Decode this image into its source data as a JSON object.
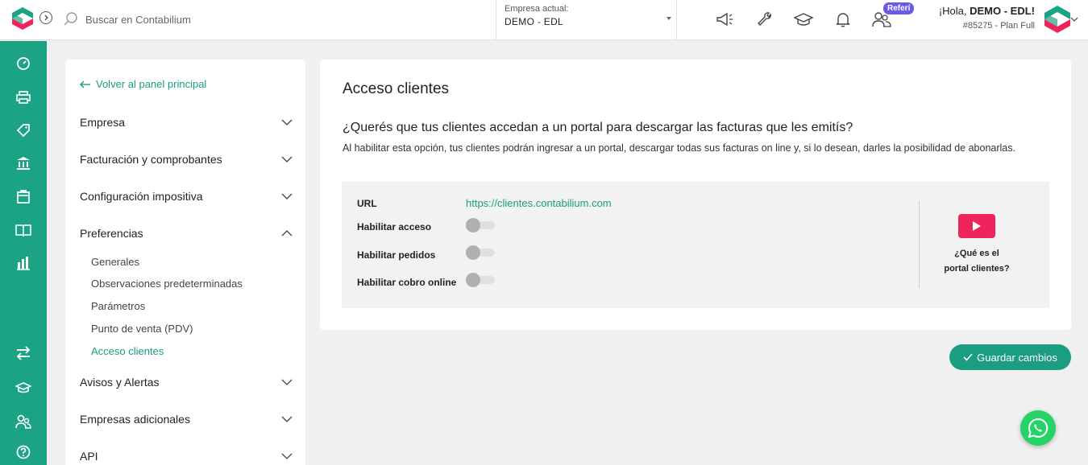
{
  "topbar": {
    "search_placeholder": "Buscar en Contabilium",
    "company_label": "Empresa actual:",
    "company_value": "DEMO - EDL",
    "referi_badge": "Referí",
    "greeting_prefix": "¡Hola, ",
    "user_name": "DEMO - EDL!",
    "plan": "#85275 - Plan Full",
    "icons": [
      "megaphone-icon",
      "wrench-icon",
      "graduation-cap-icon",
      "bell-icon",
      "users-icon"
    ]
  },
  "rail": {
    "icons": [
      "dashboard-icon",
      "printer-icon",
      "tag-icon",
      "bank-icon",
      "bag-icon",
      "book-icon",
      "chart-icon",
      "transfer-icon",
      "academy-icon",
      "contacts-icon",
      "help-icon"
    ]
  },
  "settings": {
    "back_label": "Volver al panel principal",
    "sections": [
      {
        "label": "Empresa",
        "expanded": false
      },
      {
        "label": "Facturación y comprobantes",
        "expanded": false
      },
      {
        "label": "Configuración impositiva",
        "expanded": false
      },
      {
        "label": "Preferencias",
        "expanded": true
      },
      {
        "label": "Avisos y Alertas",
        "expanded": false
      },
      {
        "label": "Empresas adicionales",
        "expanded": false
      },
      {
        "label": "API",
        "expanded": false
      }
    ],
    "preferencias_items": [
      {
        "label": "Generales",
        "active": false
      },
      {
        "label": "Observaciones predeterminadas",
        "active": false
      },
      {
        "label": "Parámetros",
        "active": false
      },
      {
        "label": "Punto de venta (PDV)",
        "active": false
      },
      {
        "label": "Acceso clientes",
        "active": true
      }
    ]
  },
  "main": {
    "title": "Acceso clientes",
    "question": "¿Querés que tus clientes accedan a un portal para descargar las facturas que les emitís?",
    "description": "Al habilitar esta opción, tus clientes podrán ingresar a un portal, descargar todas sus facturas on line y, si lo desean, darles la posibilidad de abonarlas.",
    "url_label": "URL",
    "url_value": "https://clientes.contabilium.com",
    "toggles": [
      {
        "label": "Habilitar acceso",
        "on": false
      },
      {
        "label": "Habilitar pedidos",
        "on": false
      },
      {
        "label": "Habilitar cobro online",
        "on": false
      }
    ],
    "video_caption_line1": "¿Qué es el",
    "video_caption_line2": "portal clientes?",
    "save_label": "Guardar cambios"
  },
  "colors": {
    "brand_green": "#1ca386",
    "link_green": "#1a9d80",
    "badge_purple": "#6b5ce7",
    "video_red": "#f0245c",
    "whatsapp_green": "#25d366"
  }
}
